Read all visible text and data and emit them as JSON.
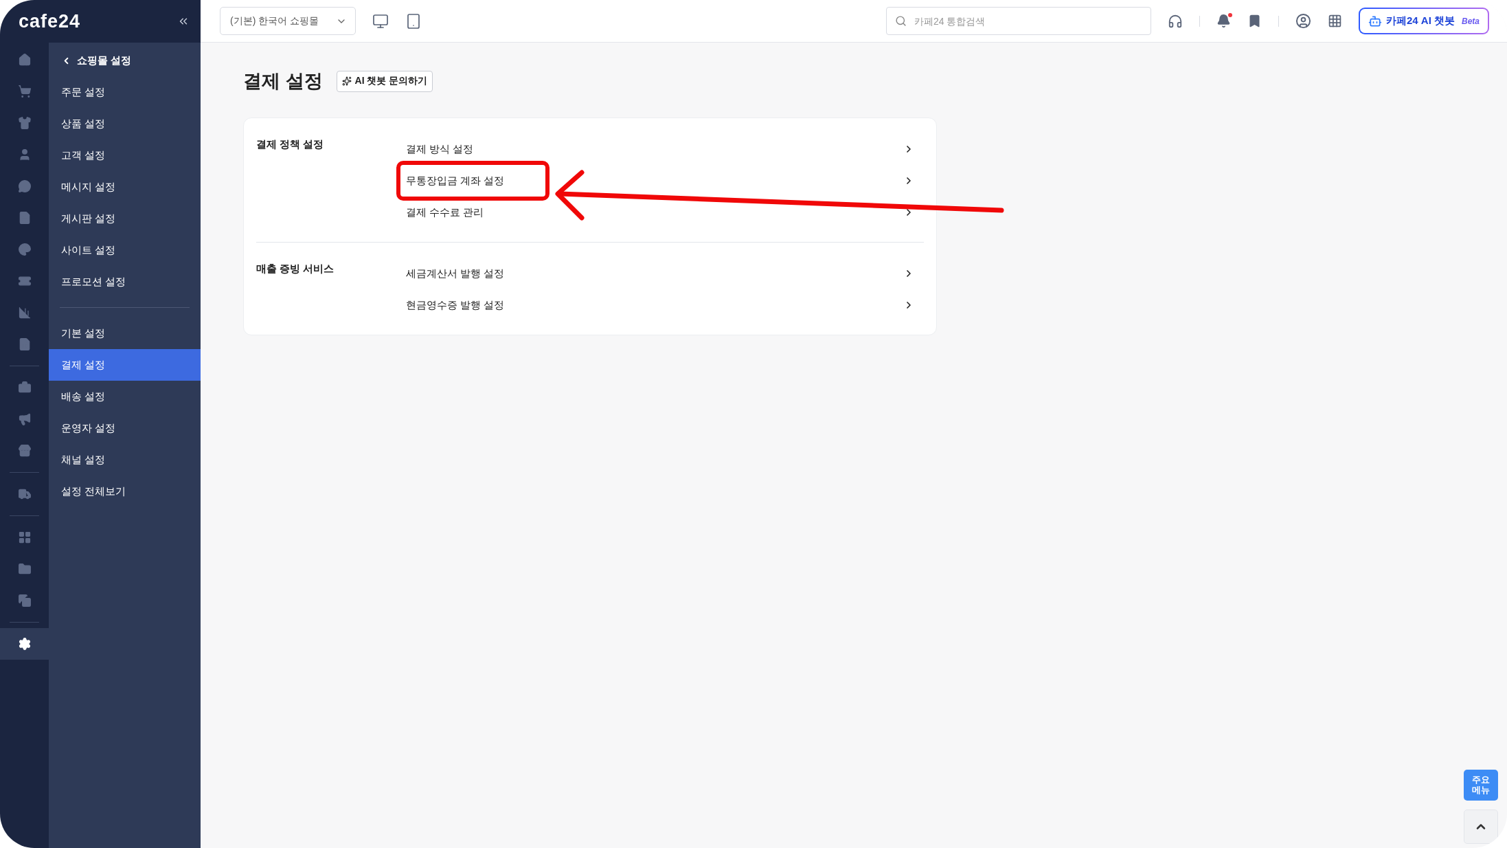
{
  "logo": "cafe24",
  "rail_groups": [
    [
      {
        "selected": false
      },
      {
        "selected": false
      },
      {
        "selected": false
      },
      {
        "selected": false
      },
      {
        "selected": false
      },
      {
        "selected": false
      },
      {
        "selected": false
      },
      {
        "selected": false
      },
      {
        "selected": false
      },
      {
        "selected": false
      }
    ],
    [
      {
        "selected": false
      },
      {
        "selected": false
      },
      {
        "selected": false
      }
    ],
    [
      {
        "selected": false
      }
    ],
    [
      {
        "selected": false
      },
      {
        "selected": false
      },
      {
        "selected": false
      }
    ],
    [
      {
        "selected": true
      }
    ]
  ],
  "sidebar": {
    "back_link": "쇼핑몰 설정",
    "groups": [
      [
        {
          "label": "주문 설정",
          "selected": false
        },
        {
          "label": "상품 설정",
          "selected": false
        },
        {
          "label": "고객 설정",
          "selected": false
        },
        {
          "label": "메시지 설정",
          "selected": false
        },
        {
          "label": "게시판 설정",
          "selected": false
        },
        {
          "label": "사이트 설정",
          "selected": false
        },
        {
          "label": "프로모션 설정",
          "selected": false
        }
      ],
      [
        {
          "label": "기본 설정",
          "selected": false
        },
        {
          "label": "결제 설정",
          "selected": true
        },
        {
          "label": "배송 설정",
          "selected": false
        },
        {
          "label": "운영자 설정",
          "selected": false
        },
        {
          "label": "채널 설정",
          "selected": false
        },
        {
          "label": "설정 전체보기",
          "selected": false
        }
      ]
    ]
  },
  "topbar": {
    "store_select": "(기본) 한국어 쇼핑몰",
    "search": {
      "placeholder": "카페24 통합검색"
    },
    "notifications_unread": true,
    "chatbot_button": {
      "label": "카페24 AI 챗봇",
      "badge": "Beta"
    }
  },
  "page": {
    "title": "결제 설정",
    "ai_button": "AI 챗봇 문의하기",
    "sections": [
      {
        "title": "결제 정책 설정",
        "links": [
          {
            "label": "결제 방식 설정",
            "highlighted": false
          },
          {
            "label": "무통장입금 계좌 설정",
            "highlighted": true
          },
          {
            "label": "결제 수수료 관리",
            "highlighted": false
          }
        ]
      },
      {
        "title": "매출 증빙 서비스",
        "links": [
          {
            "label": "세금계산서 발행 설정",
            "highlighted": false
          },
          {
            "label": "현금영수증 발행 설정",
            "highlighted": false
          }
        ]
      }
    ]
  },
  "quick_menu_button": "주요 메뉴"
}
